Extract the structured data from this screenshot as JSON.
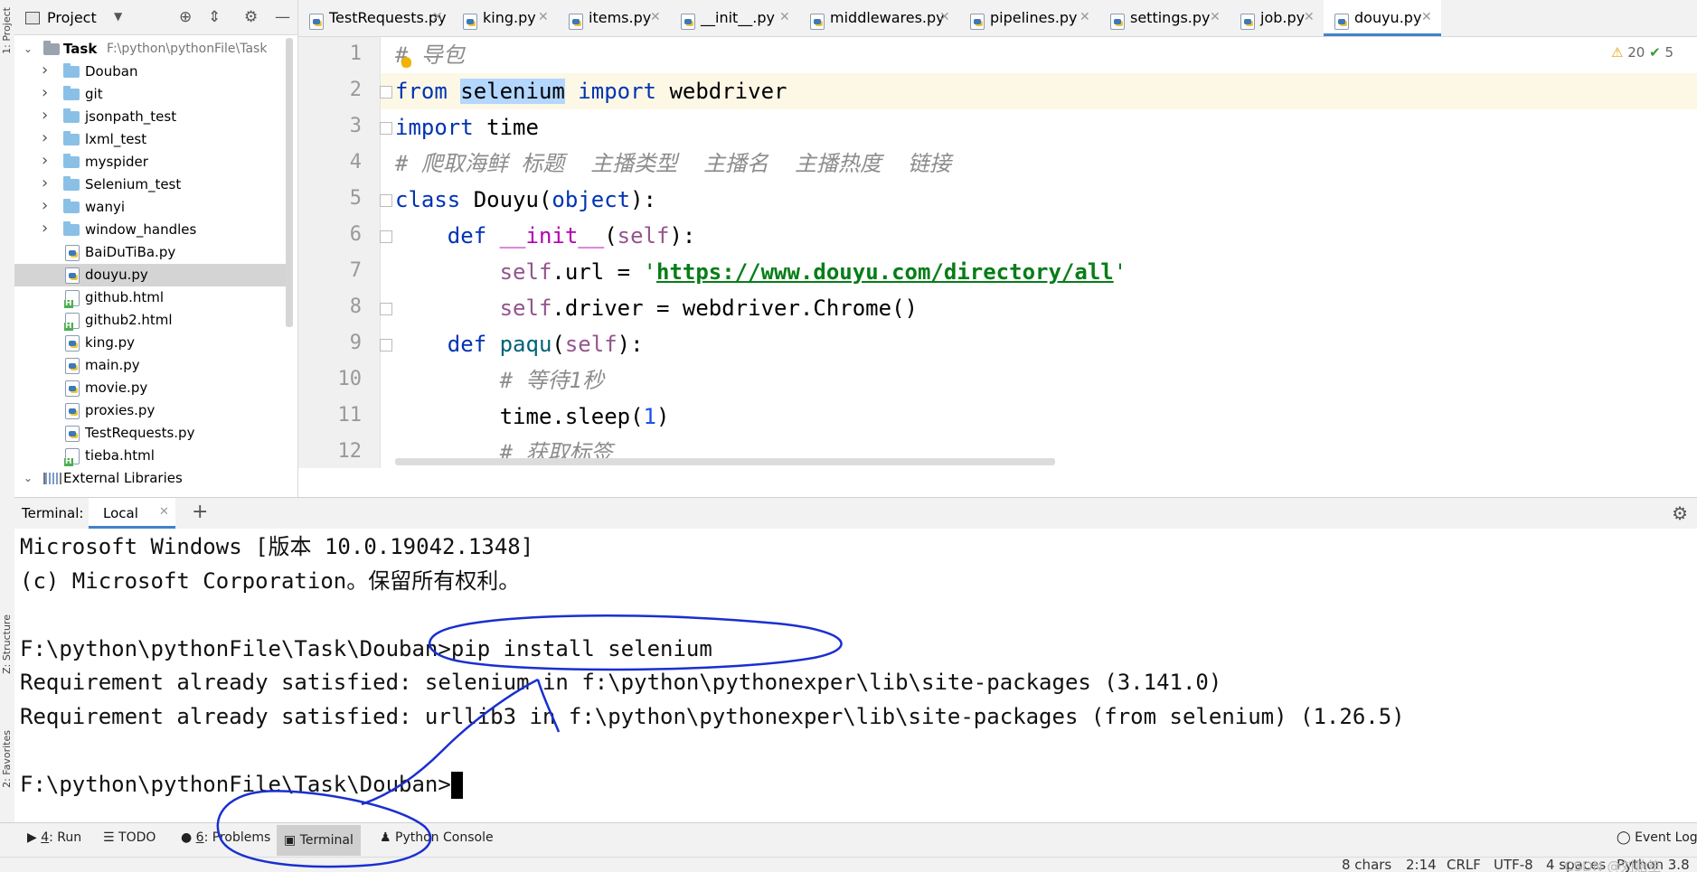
{
  "left_stripe": {
    "project": "1: Project",
    "structure": "Z: Structure",
    "favorites": "2: Favorites"
  },
  "project_panel": {
    "title": "Project",
    "tree": [
      {
        "label": "Task",
        "path": "F:\\python\\pythonFile\\Task",
        "kind": "root"
      },
      {
        "label": "Douban",
        "kind": "folder"
      },
      {
        "label": "git",
        "kind": "folder"
      },
      {
        "label": "jsonpath_test",
        "kind": "folder"
      },
      {
        "label": "lxml_test",
        "kind": "folder"
      },
      {
        "label": "myspider",
        "kind": "folder"
      },
      {
        "label": "Selenium_test",
        "kind": "folder"
      },
      {
        "label": "wanyi",
        "kind": "folder"
      },
      {
        "label": "window_handles",
        "kind": "folder"
      },
      {
        "label": "BaiDuTiBa.py",
        "kind": "py"
      },
      {
        "label": "douyu.py",
        "kind": "py",
        "selected": true
      },
      {
        "label": "github.html",
        "kind": "html"
      },
      {
        "label": "github2.html",
        "kind": "html"
      },
      {
        "label": "king.py",
        "kind": "py"
      },
      {
        "label": "main.py",
        "kind": "py"
      },
      {
        "label": "movie.py",
        "kind": "py"
      },
      {
        "label": "proxies.py",
        "kind": "py"
      },
      {
        "label": "TestRequests.py",
        "kind": "py"
      },
      {
        "label": "tieba.html",
        "kind": "html"
      },
      {
        "label": "External Libraries",
        "kind": "lib"
      }
    ]
  },
  "tabs": [
    {
      "label": "TestRequests.py"
    },
    {
      "label": "king.py"
    },
    {
      "label": "items.py"
    },
    {
      "label": "__init__.py"
    },
    {
      "label": "middlewares.py"
    },
    {
      "label": "pipelines.py"
    },
    {
      "label": "settings.py"
    },
    {
      "label": "job.py"
    },
    {
      "label": "douyu.py",
      "active": true
    }
  ],
  "editor": {
    "warnings": "20",
    "checks": "5",
    "lines": [
      {
        "n": "1",
        "tokens": [
          [
            "cm",
            "# 导包"
          ]
        ]
      },
      {
        "n": "2",
        "tokens": [
          [
            "kw",
            "from "
          ],
          [
            "hl",
            "selenium"
          ],
          [
            "kw",
            " import "
          ],
          [
            "",
            "webdriver"
          ]
        ]
      },
      {
        "n": "3",
        "tokens": [
          [
            "kw",
            "import "
          ],
          [
            "",
            "time"
          ]
        ]
      },
      {
        "n": "4",
        "tokens": [
          [
            "cm",
            "# 爬取海鲜 标题  主播类型  主播名  主播热度  链接"
          ]
        ]
      },
      {
        "n": "5",
        "tokens": [
          [
            "kw",
            "class "
          ],
          [
            "",
            "Douyu("
          ],
          [
            "kw",
            "object"
          ],
          [
            "",
            "):"
          ]
        ]
      },
      {
        "n": "6",
        "tokens": [
          [
            "",
            "    "
          ],
          [
            "kw",
            "def "
          ],
          [
            "magic",
            "__init__"
          ],
          [
            "",
            "("
          ],
          [
            "sf",
            "self"
          ],
          [
            "",
            "):"
          ]
        ]
      },
      {
        "n": "7",
        "tokens": [
          [
            "",
            "        "
          ],
          [
            "sf",
            "self"
          ],
          [
            "",
            ".url = "
          ],
          [
            "str",
            "'"
          ],
          [
            "url",
            "https://www.douyu.com/directory/all"
          ],
          [
            "str",
            "'"
          ]
        ]
      },
      {
        "n": "8",
        "tokens": [
          [
            "",
            "        "
          ],
          [
            "sf",
            "self"
          ],
          [
            "",
            ".driver = webdriver.Chrome()"
          ]
        ]
      },
      {
        "n": "9",
        "tokens": [
          [
            "",
            "    "
          ],
          [
            "kw",
            "def "
          ],
          [
            "fn",
            "paqu"
          ],
          [
            "",
            "("
          ],
          [
            "sf",
            "self"
          ],
          [
            "",
            "):"
          ]
        ]
      },
      {
        "n": "10",
        "tokens": [
          [
            "",
            "        "
          ],
          [
            "cm",
            "# 等待1秒"
          ]
        ]
      },
      {
        "n": "11",
        "tokens": [
          [
            "",
            "        "
          ],
          [
            "",
            "time.sleep("
          ],
          [
            "num",
            "1"
          ],
          [
            "",
            ")"
          ]
        ]
      },
      {
        "n": "12",
        "tokens": [
          [
            "",
            "        "
          ],
          [
            "cm",
            "# 获取标签"
          ]
        ]
      }
    ]
  },
  "terminal": {
    "label": "Terminal:",
    "tab": "Local",
    "lines": [
      "Microsoft Windows [版本 10.0.19042.1348]",
      "(c) Microsoft Corporation。保留所有权利。",
      "",
      "F:\\python\\pythonFile\\Task\\Douban>pip install selenium",
      "Requirement already satisfied: selenium in f:\\python\\pythonexper\\lib\\site-packages (3.141.0)",
      "Requirement already satisfied: urllib3 in f:\\python\\pythonexper\\lib\\site-packages (from selenium) (1.26.5)",
      "",
      "F:\\python\\pythonFile\\Task\\Douban>"
    ]
  },
  "toolbar": {
    "run_num": "4",
    "run": ": Run",
    "todo": "TODO",
    "problems_num": "6",
    "problems": ": Problems",
    "terminal": "Terminal",
    "python_console": "Python Console",
    "event_log": "Event Log"
  },
  "status": {
    "chars": "8 chars",
    "pos": "2:14",
    "crlf": "CRLF",
    "enc": "UTF-8",
    "indent": "4 spaces",
    "python": "Python 3.8",
    "watermark": "CSDN @刘贻笙"
  }
}
